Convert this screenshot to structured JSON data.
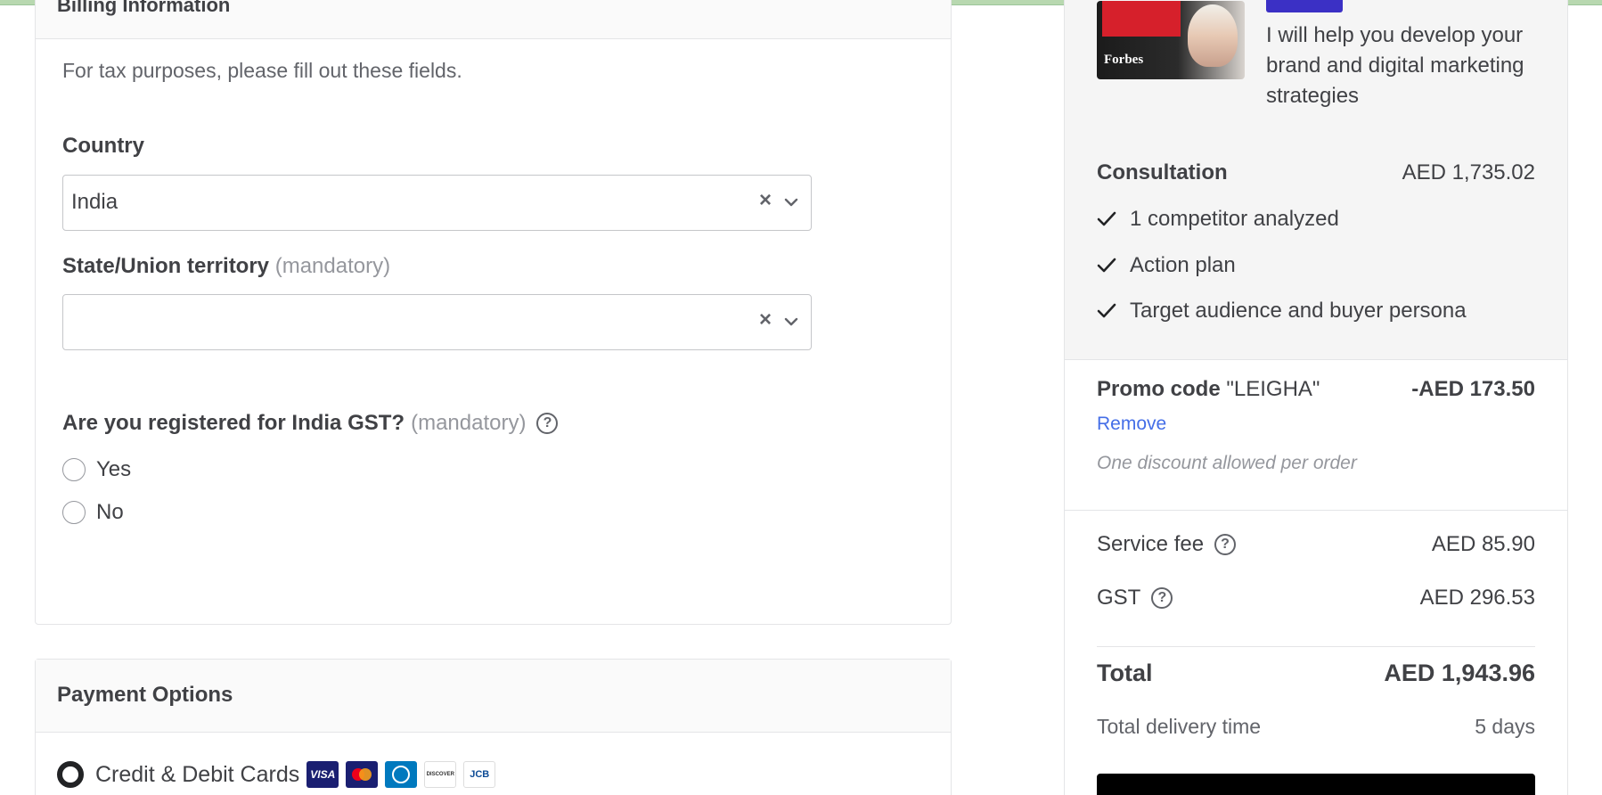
{
  "billing": {
    "header_title": "Billing Information",
    "tax_note": "For tax purposes, please fill out these fields.",
    "country": {
      "label": "Country",
      "value": "India"
    },
    "state": {
      "label": "State/Union territory",
      "mandatory": "(mandatory)",
      "value": ""
    },
    "gst": {
      "question": "Are you registered for India GST?",
      "mandatory": "(mandatory)",
      "options": [
        "Yes",
        "No"
      ]
    }
  },
  "payment": {
    "header_title": "Payment Options",
    "option_label": "Credit & Debit Cards",
    "card_logos": [
      "VISA",
      "mastercard",
      "diners",
      "DISCOVER",
      "JCB"
    ]
  },
  "summary": {
    "gig_title": "I will help you develop your brand and digital marketing strategies",
    "thumbnail_text": "Forbes",
    "package": {
      "name": "Consultation",
      "price": "AED 1,735.02",
      "features": [
        "1 competitor analyzed",
        "Action plan",
        "Target audience and buyer persona"
      ]
    },
    "promo": {
      "label": "Promo code",
      "code": "\"LEIGHA\"",
      "amount": "-AED 173.50",
      "remove": "Remove",
      "note": "One discount allowed per order"
    },
    "fees": [
      {
        "label": "Service fee",
        "value": "AED 85.90"
      },
      {
        "label": "GST",
        "value": "AED 296.53"
      }
    ],
    "total": {
      "label": "Total",
      "value": "AED 1,943.96"
    },
    "delivery": {
      "label": "Total delivery time",
      "value": "5 days"
    }
  },
  "colors": {
    "accent_link": "#446ee7",
    "badge": "#3b30c5",
    "text": "#404145",
    "muted": "#95979d"
  }
}
